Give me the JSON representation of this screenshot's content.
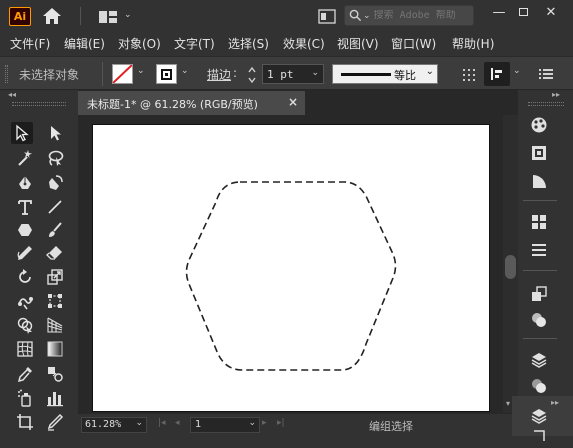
{
  "app": {
    "logo_text": "Ai"
  },
  "search": {
    "placeholder": "搜索 Adobe 帮助"
  },
  "menu": [
    "文件(F)",
    "编辑(E)",
    "对象(O)",
    "文字(T)",
    "选择(S)",
    "效果(C)",
    "视图(V)",
    "窗口(W)",
    "帮助(H)"
  ],
  "control": {
    "selection_status": "未选择对象",
    "stroke_label": "描边",
    "stroke_weight": "1 pt",
    "profile_label": "等比"
  },
  "document": {
    "tab_title": "未标题-1* @ 61.28% (RGB/预览)"
  },
  "status": {
    "zoom": "61.28%",
    "artboard": "1",
    "tool_status": "编组选择"
  },
  "colors": {
    "accent_logo": "#ff9a00",
    "logo_bg": "#330000",
    "artboard": "#ffffff",
    "canvas": "#282828",
    "panel": "#323232"
  },
  "icons": {
    "tools": [
      "selection-tool-icon",
      "direct-selection-tool-icon",
      "magic-wand-icon",
      "lasso-icon",
      "pen-tool-icon",
      "curvature-tool-icon",
      "type-tool-icon",
      "line-tool-icon",
      "polygon-tool-icon",
      "paintbrush-icon",
      "pencil-icon",
      "eraser-icon",
      "rotate-tool-icon",
      "scale-tool-icon",
      "puppet-warp-icon",
      "free-transform-icon",
      "shape-builder-icon",
      "perspective-grid-icon",
      "mesh-tool-icon",
      "gradient-tool-icon",
      "eyedropper-icon",
      "blend-tool-icon",
      "symbol-sprayer-icon",
      "column-graph-icon",
      "artboard-tool-icon",
      "slice-tool-icon"
    ],
    "panels": [
      "color-panel-icon",
      "color-guide-icon",
      "stroke-panel-icon",
      "swatches-icon",
      "align-icon",
      "transform-icon",
      "pathfinder-icon",
      "layers-icon",
      "appearance-icon",
      "artboards-icon"
    ]
  }
}
